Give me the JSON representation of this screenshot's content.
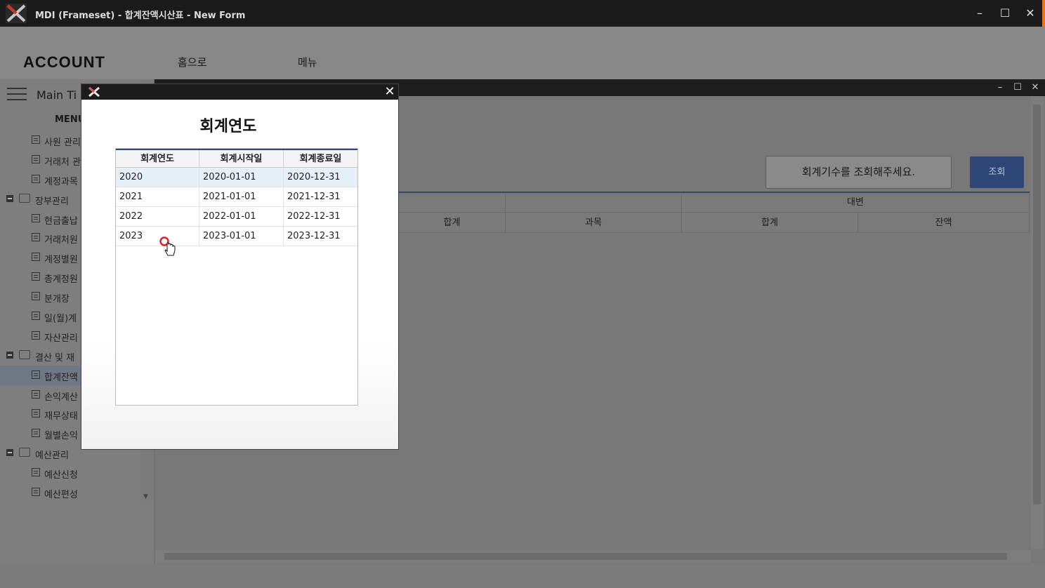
{
  "window": {
    "title": "MDI (Frameset) - 합계잔액시산표 - New Form",
    "controls": {
      "minimize": "–",
      "maximize": "☐",
      "close": "✕"
    },
    "accent_color": "#e0761a"
  },
  "header": {
    "brand": "ACCOUNT",
    "nav": [
      "홈으로",
      "메뉴"
    ]
  },
  "sidebar": {
    "main_title": "Main Ti",
    "menu_header": "MENU",
    "items": [
      {
        "type": "leaf",
        "label": "사원 관리"
      },
      {
        "type": "leaf",
        "label": "거래처 관"
      },
      {
        "type": "leaf",
        "label": "계정과목"
      },
      {
        "type": "folder",
        "label": "장부관리"
      },
      {
        "type": "leaf",
        "label": "현금출납"
      },
      {
        "type": "leaf",
        "label": "거래처원"
      },
      {
        "type": "leaf",
        "label": "계정별원"
      },
      {
        "type": "leaf",
        "label": "총계정원"
      },
      {
        "type": "leaf",
        "label": "분개장"
      },
      {
        "type": "leaf",
        "label": "일(월)계"
      },
      {
        "type": "leaf",
        "label": "자산관리"
      },
      {
        "type": "folder",
        "label": "결산 및 재"
      },
      {
        "type": "leaf",
        "label": "합계잔액",
        "selected": true
      },
      {
        "type": "leaf",
        "label": "손익계산"
      },
      {
        "type": "leaf",
        "label": "재무상태"
      },
      {
        "type": "leaf",
        "label": "월별손익"
      },
      {
        "type": "folder",
        "label": "예산관리"
      },
      {
        "type": "leaf",
        "label": "예산신청"
      },
      {
        "type": "leaf",
        "label": "예산편성"
      }
    ]
  },
  "content": {
    "fiscal_hint": "회계기수를 조회해주세요.",
    "query_button": "조회",
    "grid": {
      "group_header": "대변",
      "columns": [
        "합계",
        "과목",
        "합계",
        "잔액"
      ]
    }
  },
  "modal": {
    "title": "회계연도",
    "close": "✕",
    "table": {
      "headers": [
        "회계연도",
        "회계시작일",
        "회계종료일"
      ],
      "rows": [
        {
          "year": "2020",
          "start": "2020-01-01",
          "end": "2020-12-31",
          "selected": true
        },
        {
          "year": "2021",
          "start": "2021-01-01",
          "end": "2021-12-31"
        },
        {
          "year": "2022",
          "start": "2022-01-01",
          "end": "2022-12-31"
        },
        {
          "year": "2023",
          "start": "2023-01-01",
          "end": "2023-12-31"
        }
      ]
    }
  },
  "colors": {
    "primary": "#2e4778",
    "selection": "#e6eef8",
    "overlay": "#7a7a7a"
  }
}
